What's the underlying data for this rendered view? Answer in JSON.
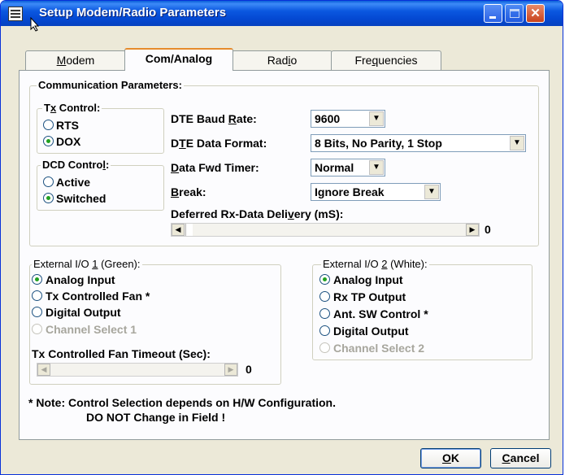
{
  "window": {
    "title": "Setup Modem/Radio Parameters",
    "buttons": {
      "minimize": "minimize",
      "maximize": "maximize",
      "close": "✕"
    }
  },
  "tabs": [
    {
      "label_pre": "",
      "hotkey": "M",
      "label_post": "odem"
    },
    {
      "label_pre": "Com/Analo",
      "hotkey": "g",
      "label_post": ""
    },
    {
      "label_pre": "Rad",
      "hotkey": "i",
      "label_post": "o"
    },
    {
      "label_pre": "Fre",
      "hotkey": "q",
      "label_post": "uencies"
    }
  ],
  "active_tab_index": 1,
  "comm": {
    "group_label": "Communication Parameters:",
    "tx_control": {
      "label_pre": "T",
      "hotkey": "x",
      "label_post": " Control:",
      "options": [
        "RTS",
        "DOX"
      ],
      "selected": "DOX"
    },
    "dcd_control": {
      "label_pre": "DCD Contro",
      "hotkey": "l",
      "label_post": ":",
      "options": [
        "Active",
        "Switched"
      ],
      "selected": "Switched"
    },
    "baud": {
      "label_pre": "DTE Baud ",
      "hotkey": "R",
      "label_post": "ate:",
      "value": "9600"
    },
    "format": {
      "label_pre": "D",
      "hotkey": "T",
      "label_post": "E Data Format:",
      "value": "8 Bits, No Parity, 1 Stop"
    },
    "fwd_timer": {
      "label_pre": "",
      "hotkey": "D",
      "label_post": "ata Fwd Timer:",
      "value": "Normal"
    },
    "break": {
      "label_pre": "",
      "hotkey": "B",
      "label_post": "reak:",
      "value": "Ignore Break"
    },
    "deferred": {
      "label_pre": "Deferred Rx-Data Deli",
      "hotkey": "v",
      "label_post": "ery (mS):",
      "value": "0"
    }
  },
  "io1": {
    "label_pre": "External I/O ",
    "hotkey": "1",
    "label_post": " (Green):",
    "options": [
      {
        "label": "Analog Input",
        "disabled": false
      },
      {
        "label": "Tx Controlled Fan *",
        "disabled": false
      },
      {
        "label": "Digital Output",
        "disabled": false
      },
      {
        "label": "Channel Select 1",
        "disabled": true
      }
    ],
    "selected": "Analog Input",
    "fan_timeout": {
      "label": "Tx Controlled Fan Timeout (Sec):",
      "value": "0"
    }
  },
  "io2": {
    "label_pre": "External I/O ",
    "hotkey": "2",
    "label_post": " (White):",
    "options": [
      {
        "label": "Analog Input",
        "disabled": false
      },
      {
        "label": "Rx TP Output",
        "disabled": false
      },
      {
        "label": "Ant. SW Control *",
        "disabled": false
      },
      {
        "label": "Digital Output",
        "disabled": false
      },
      {
        "label": "Channel Select 2",
        "disabled": true
      }
    ],
    "selected": "Analog Input"
  },
  "note": {
    "line1": "* Note:  Control Selection depends on H/W Configuration.",
    "line2": "DO NOT Change in Field !"
  },
  "footer": {
    "ok_hotkey": "O",
    "ok_post": "K",
    "cancel_hotkey": "C",
    "cancel_post": "ancel"
  },
  "colors": {
    "title_bar": "#0b58e0",
    "tab_highlight": "#e68b2c",
    "radio_dot": "#21a121",
    "face": "#ece9d8"
  }
}
